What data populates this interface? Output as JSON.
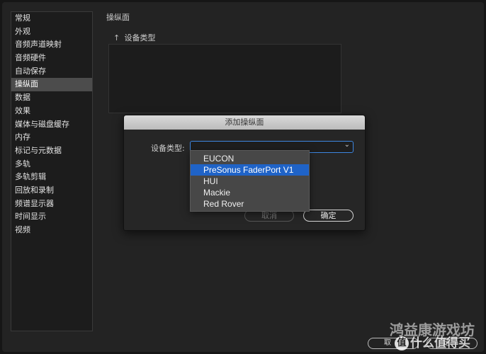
{
  "sidebar": {
    "items": [
      {
        "label": "常规"
      },
      {
        "label": "外观"
      },
      {
        "label": "音频声道映射"
      },
      {
        "label": "音频硬件"
      },
      {
        "label": "自动保存"
      },
      {
        "label": "操纵面",
        "active": true
      },
      {
        "label": "数据"
      },
      {
        "label": "效果"
      },
      {
        "label": "媒体与磁盘缓存"
      },
      {
        "label": "内存"
      },
      {
        "label": "标记与元数据"
      },
      {
        "label": "多轨"
      },
      {
        "label": "多轨剪辑"
      },
      {
        "label": "回放和录制"
      },
      {
        "label": "频谱显示器"
      },
      {
        "label": "时间显示"
      },
      {
        "label": "视频"
      }
    ]
  },
  "main": {
    "section_title": "操纵面",
    "column_header": "设备类型",
    "sort_icon": "up-arrow"
  },
  "dialog": {
    "title": "添加操纵面",
    "field_label": "设备类型:",
    "select_value": "",
    "cancel_label": "取消",
    "ok_label": "确定"
  },
  "dropdown": {
    "options": [
      {
        "label": "EUCON"
      },
      {
        "label": "PreSonus FaderPort V1",
        "selected": true
      },
      {
        "label": "HUI"
      },
      {
        "label": "Mackie"
      },
      {
        "label": "Red Rover"
      }
    ]
  },
  "bottom": {
    "cancel_label": "取",
    "ok_label": "定"
  },
  "watermark": {
    "line1": "鸿益康游戏坊",
    "line2": "什么值得买",
    "badge": "值"
  },
  "colors": {
    "selection": "#1f63c7",
    "focus_ring": "#3d86e0",
    "sidebar_active": "#4c4c4c"
  }
}
